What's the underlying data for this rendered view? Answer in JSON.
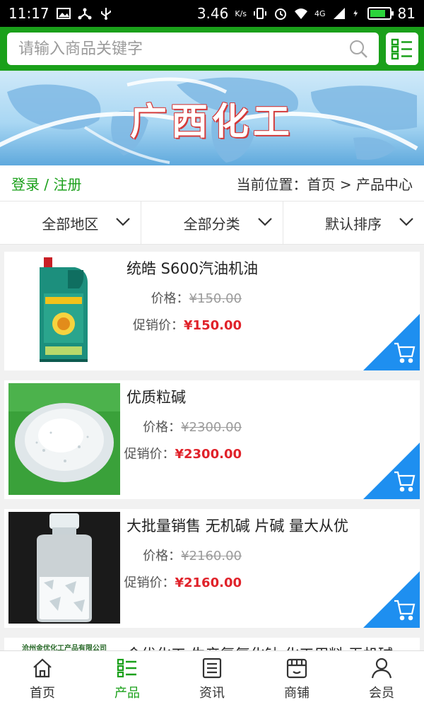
{
  "status_bar": {
    "time": "11:17",
    "speed": "3.46",
    "speed_unit": "K/s",
    "network": "4G",
    "battery": "81",
    "battery_level": 0.81
  },
  "search": {
    "placeholder": "请输入商品关键字"
  },
  "banner": {
    "title": "广西化工"
  },
  "auth": {
    "login": "登录",
    "separator": " / ",
    "register": "注册"
  },
  "breadcrumb": "当前位置：首页 > 产品中心",
  "filters": [
    "全部地区",
    "全部分类",
    "默认排序"
  ],
  "products": [
    {
      "name": "统皓 S600汽油机油",
      "price_label": "价格：",
      "price": "¥150.00",
      "promo_label": "促销价：",
      "promo_price": "¥150.00"
    },
    {
      "name": "优质粒碱",
      "price_label": "价格：",
      "price": "¥2300.00",
      "promo_label": "促销价：",
      "promo_price": "¥2300.00"
    },
    {
      "name": "大批量销售 无机碱 片碱 量大从优",
      "price_label": "价格：",
      "price": "¥2160.00",
      "promo_label": "促销价：",
      "promo_price": "¥2160.00"
    },
    {
      "name": "金优化工 生产氢氧化钠 化工用料 无机碱",
      "thumb_caption": "沧州金优化工产品有限公司"
    }
  ],
  "bottom_nav": [
    {
      "label": "首页",
      "icon": "home-icon"
    },
    {
      "label": "产品",
      "icon": "list-icon"
    },
    {
      "label": "资讯",
      "icon": "news-icon"
    },
    {
      "label": "商铺",
      "icon": "store-icon"
    },
    {
      "label": "会员",
      "icon": "user-icon"
    }
  ],
  "colors": {
    "brand_green": "#1aa01a",
    "promo_red": "#e0222a",
    "cart_blue": "#1e8ff0"
  }
}
